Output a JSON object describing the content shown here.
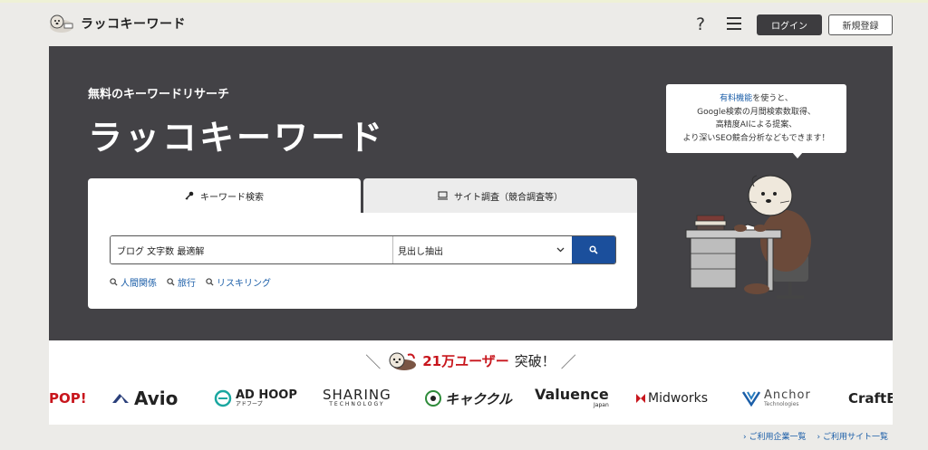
{
  "header": {
    "logo_text": "ラッコキーワード",
    "help_icon": "?",
    "login_label": "ログイン",
    "signup_label": "新規登録"
  },
  "hero": {
    "subtitle": "無料のキーワードリサーチ",
    "title": "ラッコキーワード",
    "tabs": [
      {
        "label": "キーワード検索",
        "icon": "key-icon",
        "active": true
      },
      {
        "label": "サイト調査（競合調査等）",
        "icon": "monitor-icon",
        "active": false
      }
    ],
    "search": {
      "value": "ブログ 文字数 最適解",
      "mode": "見出し抽出"
    },
    "suggestions": [
      "人間関係",
      "旅行",
      "リスキリング"
    ],
    "bubble": {
      "link_text": "有料機能",
      "line1_rest": "を使うと、",
      "line2": "Google検索の月間検索数取得、",
      "line3": "高精度AIによる提案、",
      "line4": "より深いSEO競合分析などもできます！"
    }
  },
  "users_band": {
    "count": "21万ユーザー",
    "suffix": "突破！",
    "slash_left": "＼",
    "slash_right": "／"
  },
  "brands": {
    "pop": "POP!",
    "avio": "Avio",
    "adhoop": "AD HOOP",
    "adhoop_sub": "アドフープ",
    "sharing": "SHARING",
    "sharing_sub": "TECHNOLOGY",
    "kyakkuru": "キャククル",
    "valuence": "Valuence",
    "valuence_sub": "Japan",
    "midworks": "Midworks",
    "anchor": "Anchor",
    "anchor_sub": "Technologies",
    "craft": "CraftB"
  },
  "footer": {
    "links": [
      "ご利用企業一覧",
      "ご利用サイト一覧"
    ]
  },
  "colors": {
    "hero_bg": "#434246",
    "accent_blue": "#1b4f9c",
    "highlight_red": "#c8161d"
  }
}
